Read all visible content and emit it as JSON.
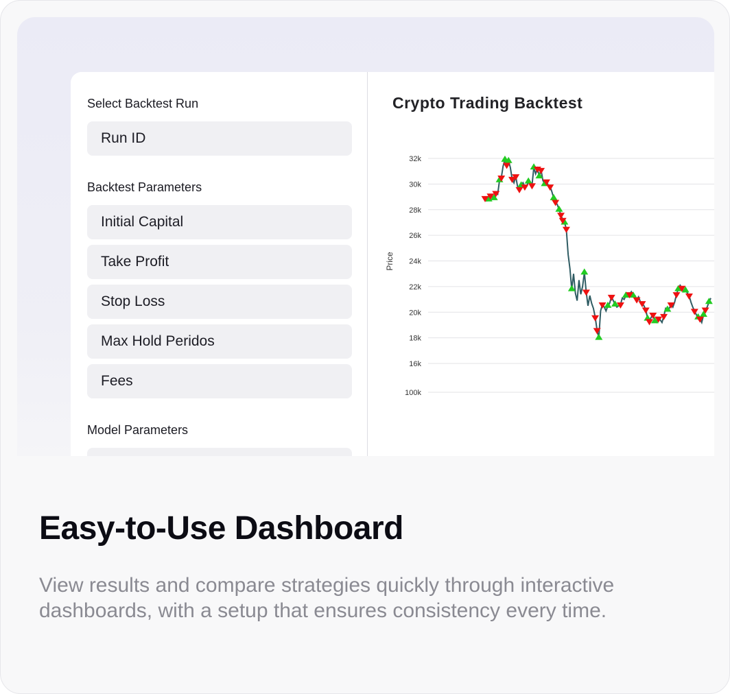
{
  "sidebar": {
    "select_run_label": "Select Backtest Run",
    "run_field_placeholder": "Run ID",
    "backtest_params_label": "Backtest Parameters",
    "backtest_params": [
      "Initial Capital",
      "Take Profit",
      "Stop Loss",
      "Max Hold Peridos",
      "Fees"
    ],
    "model_params_label": "Model Parameters"
  },
  "chart_title": "Crypto Trading Backtest",
  "chart_data": {
    "type": "line",
    "title": "Crypto Trading Backtest",
    "ylabel": "Price",
    "xlabel": "",
    "y_ticks": [
      "32k",
      "30k",
      "28k",
      "26k",
      "24k",
      "22k",
      "20k",
      "18k",
      "16k"
    ],
    "lower_axis_tick": "100k",
    "ylim": [
      16000,
      32000
    ],
    "grid": true,
    "colors": {
      "line": "#2f5c63",
      "buy": "#22cc22",
      "sell": "#ee1111"
    },
    "series": [
      {
        "values": [
          28900,
          28700,
          28800,
          29100,
          29000,
          28900,
          29300,
          29200,
          30300,
          30500,
          31400,
          31900,
          31500,
          31800,
          31300,
          30400,
          30100,
          30600,
          29800,
          29600,
          29900,
          30100,
          29800,
          29800,
          30200,
          30000,
          29900,
          31300,
          30800,
          31200,
          30600,
          31100,
          30300,
          30000,
          30200,
          29900,
          29800,
          29400,
          28900,
          28600,
          28400,
          28000,
          27600,
          27200,
          27000,
          26500,
          24500,
          23400,
          21800,
          23000,
          21500,
          20900,
          22500,
          21400,
          22000,
          23100,
          21600,
          20500,
          21300,
          20700,
          20300,
          19600,
          18600,
          18000,
          20100,
          20600,
          20400,
          20100,
          20500,
          20700,
          21200,
          20900,
          20600,
          20400,
          20500,
          20600,
          21100,
          21000,
          21300,
          21200,
          21400,
          21600,
          21300,
          21300,
          21000,
          21200,
          20800,
          20700,
          20500,
          20200,
          19500,
          19300,
          19600,
          19800,
          19300,
          19200,
          19500,
          19400,
          19200,
          19700,
          20300,
          20200,
          20300,
          20600,
          20400,
          20800,
          21400,
          21800,
          22100,
          21900,
          21600,
          21700,
          21500,
          21300,
          20800,
          20400,
          20100,
          19800,
          19600,
          19500,
          19200,
          19800,
          20200,
          20400,
          20800,
          21100
        ]
      }
    ],
    "buy_signals": [
      2,
      5,
      8,
      11,
      13,
      20,
      24,
      27,
      30,
      33,
      38,
      41,
      44,
      48,
      55,
      63,
      68,
      72,
      78,
      82,
      90,
      94,
      101,
      107,
      111,
      118,
      121,
      124
    ],
    "sell_signals": [
      0,
      3,
      6,
      9,
      12,
      15,
      17,
      19,
      22,
      26,
      29,
      31,
      34,
      36,
      39,
      42,
      43,
      45,
      56,
      61,
      62,
      65,
      70,
      75,
      80,
      84,
      87,
      89,
      91,
      93,
      96,
      99,
      103,
      106,
      109,
      113,
      116,
      119,
      122
    ]
  },
  "headline": "Easy-to-Use Dashboard",
  "description": "View results and compare strategies quickly through interactive dashboards, with a setup that ensures consistency every time."
}
